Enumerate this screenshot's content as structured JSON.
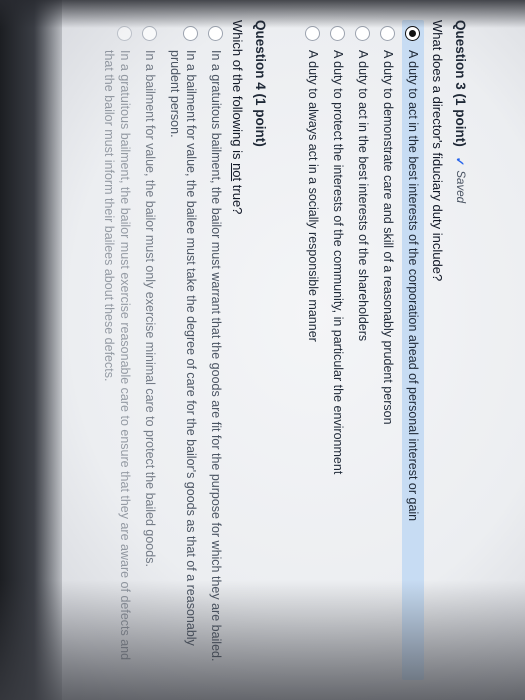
{
  "q3": {
    "title": "Question 3 (1 point)",
    "status": "Saved",
    "text": "What does a director's fiduciary duty include?",
    "options": [
      {
        "label": "A duty to act in the best interests of the corporation ahead of personal interest or gain",
        "selected": true
      },
      {
        "label": "A duty to demonstrate care and skill of a reasonably prudent person",
        "selected": false
      },
      {
        "label": "A duty to act in the best interests of the shareholders",
        "selected": false
      },
      {
        "label": "A duty to protect the interests of the community, in particular the environment",
        "selected": false
      },
      {
        "label": "A duty to always act in a socially responsible manner",
        "selected": false
      }
    ]
  },
  "q4": {
    "title": "Question 4 (1 point)",
    "text_before": "Which of the following is ",
    "text_emph": "not",
    "text_after": " true?",
    "options": [
      {
        "label": "In a gratuitous bailment, the bailor must warrant that the goods are fit for the purpose for which they are bailed."
      },
      {
        "label": "In a bailment for value, the bailee must take the degree of care for the bailor's goods as that of a reasonably prudent person."
      },
      {
        "label": "In a bailment for value, the bailor must only exercise minimal care to protect the bailed goods."
      },
      {
        "label": "In a gratuitous bailment, the bailor must exercise reasonable care to ensure that they are aware of defects and that the bailor must inform their bailees about these defects."
      }
    ]
  }
}
